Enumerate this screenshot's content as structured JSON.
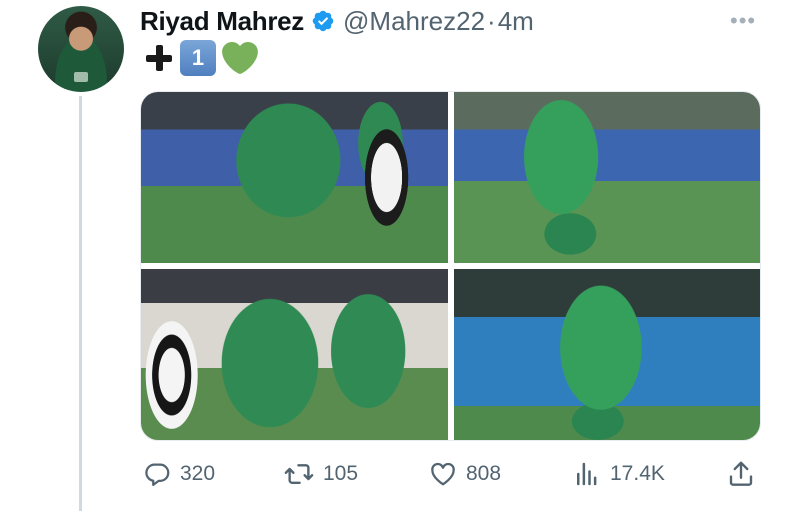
{
  "tweet": {
    "author": {
      "display_name": "Riyad Mahrez",
      "handle": "@Mahrez22",
      "verified": true
    },
    "time": "4m",
    "separator": "·",
    "text": {
      "emojis": [
        "heavy-plus-sign",
        "keycap-1",
        "green-heart"
      ],
      "keycap_digit": "1"
    },
    "media": {
      "photos": [
        {
          "name": "photo-1"
        },
        {
          "name": "photo-2"
        },
        {
          "name": "photo-3"
        },
        {
          "name": "photo-4"
        }
      ]
    },
    "actions": {
      "replies": "320",
      "retweets": "105",
      "likes": "808",
      "views": "17.4K"
    },
    "colors": {
      "verified": "#1d9bf0",
      "muted": "#536471",
      "heart": "#78b159",
      "thread_line": "#cfd9de"
    },
    "icons": {
      "more": "more-horizontal-icon",
      "reply": "reply-icon",
      "retweet": "retweet-icon",
      "like": "heart-icon",
      "views": "views-icon",
      "share": "share-icon"
    }
  }
}
